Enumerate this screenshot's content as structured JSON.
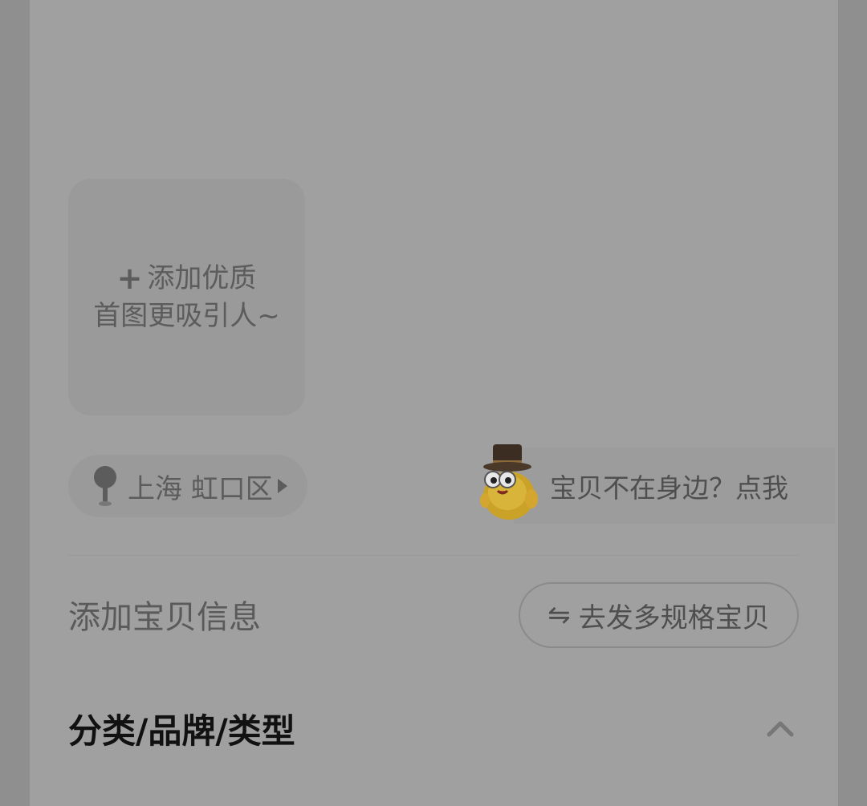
{
  "upload": {
    "plus": "+",
    "line1": "添加优质",
    "line2": "首图更吸引人~"
  },
  "location": {
    "text": "上海 虹口区"
  },
  "helper": {
    "text": "宝贝不在身边？点我"
  },
  "info": {
    "title": "添加宝贝信息",
    "multi_spec_button": "去发多规格宝贝",
    "swap_icon": "⇋"
  },
  "category": {
    "title": "分类/品牌/类型"
  },
  "icons": {
    "pin": "location-pin-icon",
    "caret": "caret-right-icon",
    "swap": "swap-arrows-icon",
    "chevron": "chevron-up-icon",
    "mascot": "top-hat-fish-mascot"
  }
}
